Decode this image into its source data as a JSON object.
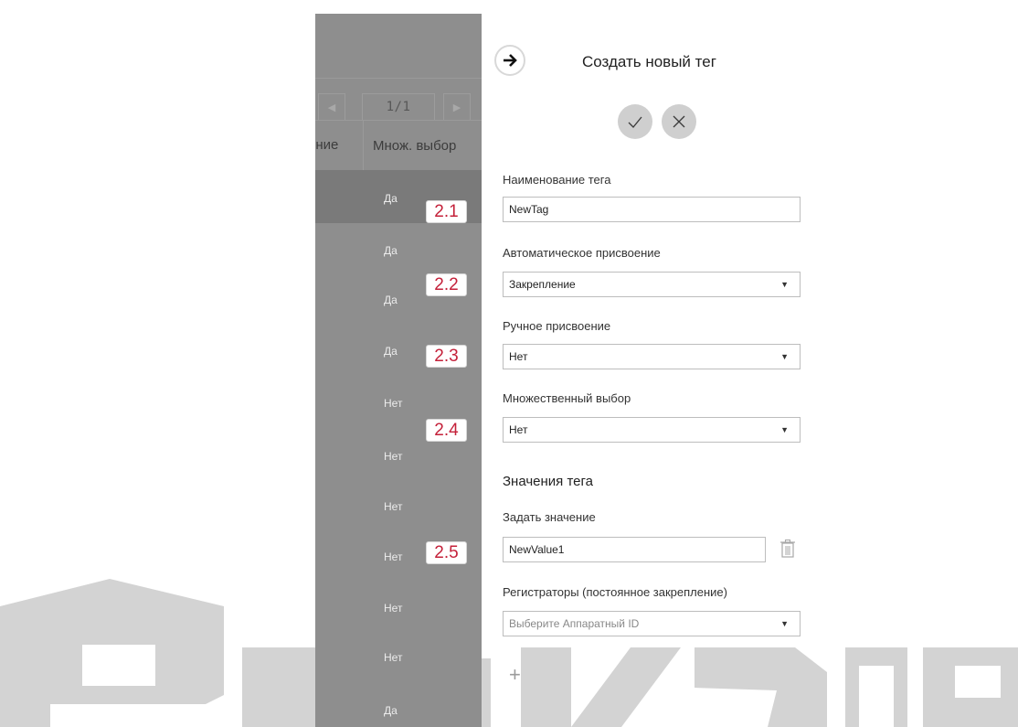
{
  "watermark": {
    "text": "РЕВИЗОР"
  },
  "table": {
    "pager": {
      "prev_icon": "chevron-left-icon",
      "next_icon": "chevron-right-icon",
      "page": "1/1"
    },
    "headers": [
      "ение",
      "Множ. выбор"
    ],
    "rows": [
      "Да",
      "Да",
      "Да",
      "Да",
      "Нет",
      "Нет",
      "Нет",
      "Нет",
      "Нет",
      "Нет",
      "Да"
    ]
  },
  "badges": [
    "2.1",
    "2.2",
    "2.3",
    "2.4",
    "2.5"
  ],
  "form": {
    "back_icon": "arrow-right-icon",
    "title": "Создать новый тег",
    "confirm_icon": "checkmark-icon",
    "cancel_icon": "close-icon",
    "tag_name": {
      "label": "Наименование тега",
      "value": "NewTag"
    },
    "auto_assign": {
      "label": "Автоматическое присвоение",
      "value": "Закрепление"
    },
    "manual_assign": {
      "label": "Ручное присвоение",
      "value": "Нет"
    },
    "multi_select": {
      "label": "Множественный выбор",
      "value": "Нет"
    },
    "values_section": {
      "title": "Значения тега"
    },
    "set_value": {
      "label": "Задать значение",
      "value": "NewValue1",
      "delete_icon": "trash-icon"
    },
    "registrators": {
      "label": "Регистраторы (постоянное закрепление)",
      "placeholder": "Выберите Аппаратный ID"
    },
    "add_icon": "plus-icon",
    "add_symbol": "+"
  },
  "colors": {
    "overlay": "#8e8e8e",
    "badge_text": "#c4213a",
    "action_btn": "#cfcfcf",
    "logo": "#d3d3d3"
  }
}
